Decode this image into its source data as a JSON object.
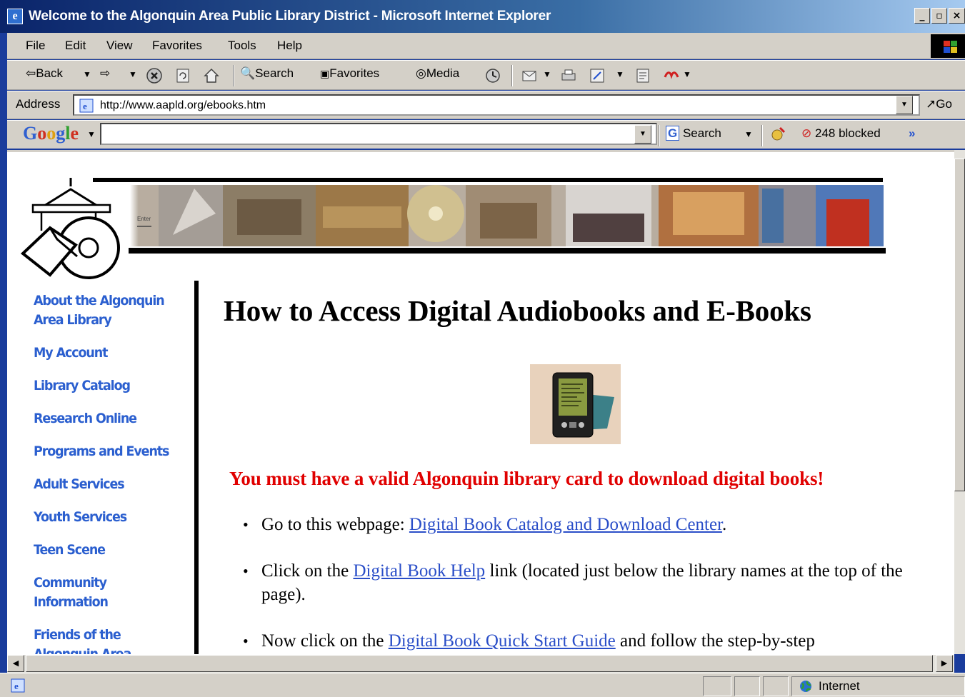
{
  "window": {
    "title": "Welcome to the Algonquin Area Public Library District - Microsoft Internet Explorer",
    "controls": [
      "_",
      "ð",
      "x"
    ]
  },
  "menu": [
    "File",
    "Edit",
    "View",
    "Favorites",
    "Tools",
    "Help"
  ],
  "toolbar": {
    "back": "Back",
    "search": "Search",
    "favorites": "Favorites",
    "media": "Media"
  },
  "address": {
    "label": "Address",
    "url": "http://www.aapld.org/ebooks.htm",
    "go": "Go"
  },
  "google_bar": {
    "logo": "Google",
    "search_value": "",
    "search_button": "Search",
    "popups_blocked": "248 blocked",
    "more": "»"
  },
  "page": {
    "banner_text_enter": "Enter",
    "sidebar": [
      "About the Algonquin Area Library",
      "My Account",
      "Library Catalog",
      "Research Online",
      "Programs and Events",
      "Adult Services",
      "Youth Services",
      "Teen Scene",
      "Community Information",
      "Friends of the Algonquin Area"
    ],
    "heading": "How to Access Digital Audiobooks and E-Books",
    "warning": "You must have a valid Algonquin library card to download digital books!",
    "steps": [
      {
        "before": "Go to this webpage: ",
        "link": "Digital Book Catalog and Download Center",
        "after": "."
      },
      {
        "before": "Click on the ",
        "link": "Digital Book Help",
        "after": " link (located just below the library names at the top of the page)."
      },
      {
        "before": "Now click on the ",
        "link": "Digital Book Quick Start Guide",
        "after": " and follow the step-by-step"
      }
    ]
  },
  "status": {
    "zone": "Internet"
  },
  "colors": {
    "title_bar": "#0a246a",
    "chrome": "#d4d0c8",
    "nav_link": "#2b5fcf",
    "warning": "#e00000",
    "link": "#2a4ec8"
  }
}
